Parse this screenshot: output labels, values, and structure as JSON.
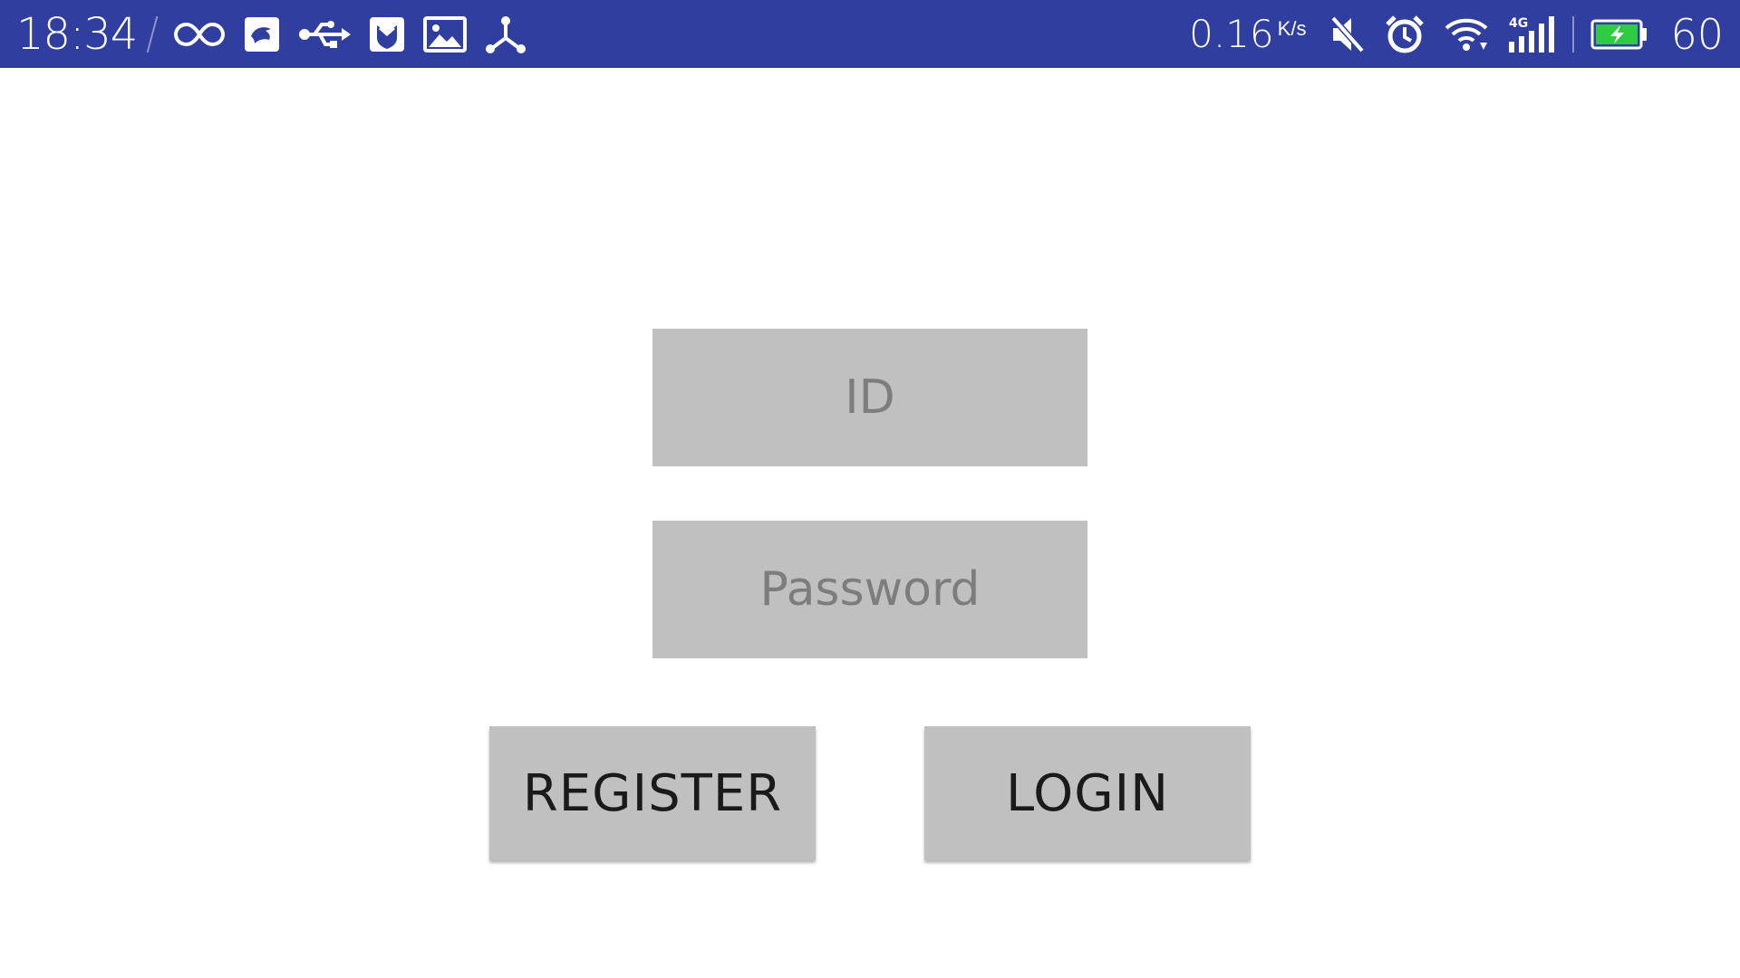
{
  "status_bar": {
    "time": "18:34",
    "left_icons": [
      "infinity-icon",
      "bird-app-icon",
      "usb-icon",
      "shield-mail-icon",
      "image-icon",
      "share-network-icon"
    ],
    "net_speed": "0.16",
    "net_speed_unit": "K/s",
    "right_icons": [
      "mute-icon",
      "alarm-icon",
      "wifi-icon",
      "4g-signal-icon",
      "battery-charging-icon"
    ],
    "network_type": "4G",
    "battery_percent": "60",
    "background_color": "#303f9f",
    "battery_color": "#2ecc40"
  },
  "login_form": {
    "id_placeholder": "ID",
    "id_value": "",
    "password_placeholder": "Password",
    "password_value": "",
    "register_label": "REGISTER",
    "login_label": "LOGIN",
    "field_color": "#c0c0c0"
  }
}
